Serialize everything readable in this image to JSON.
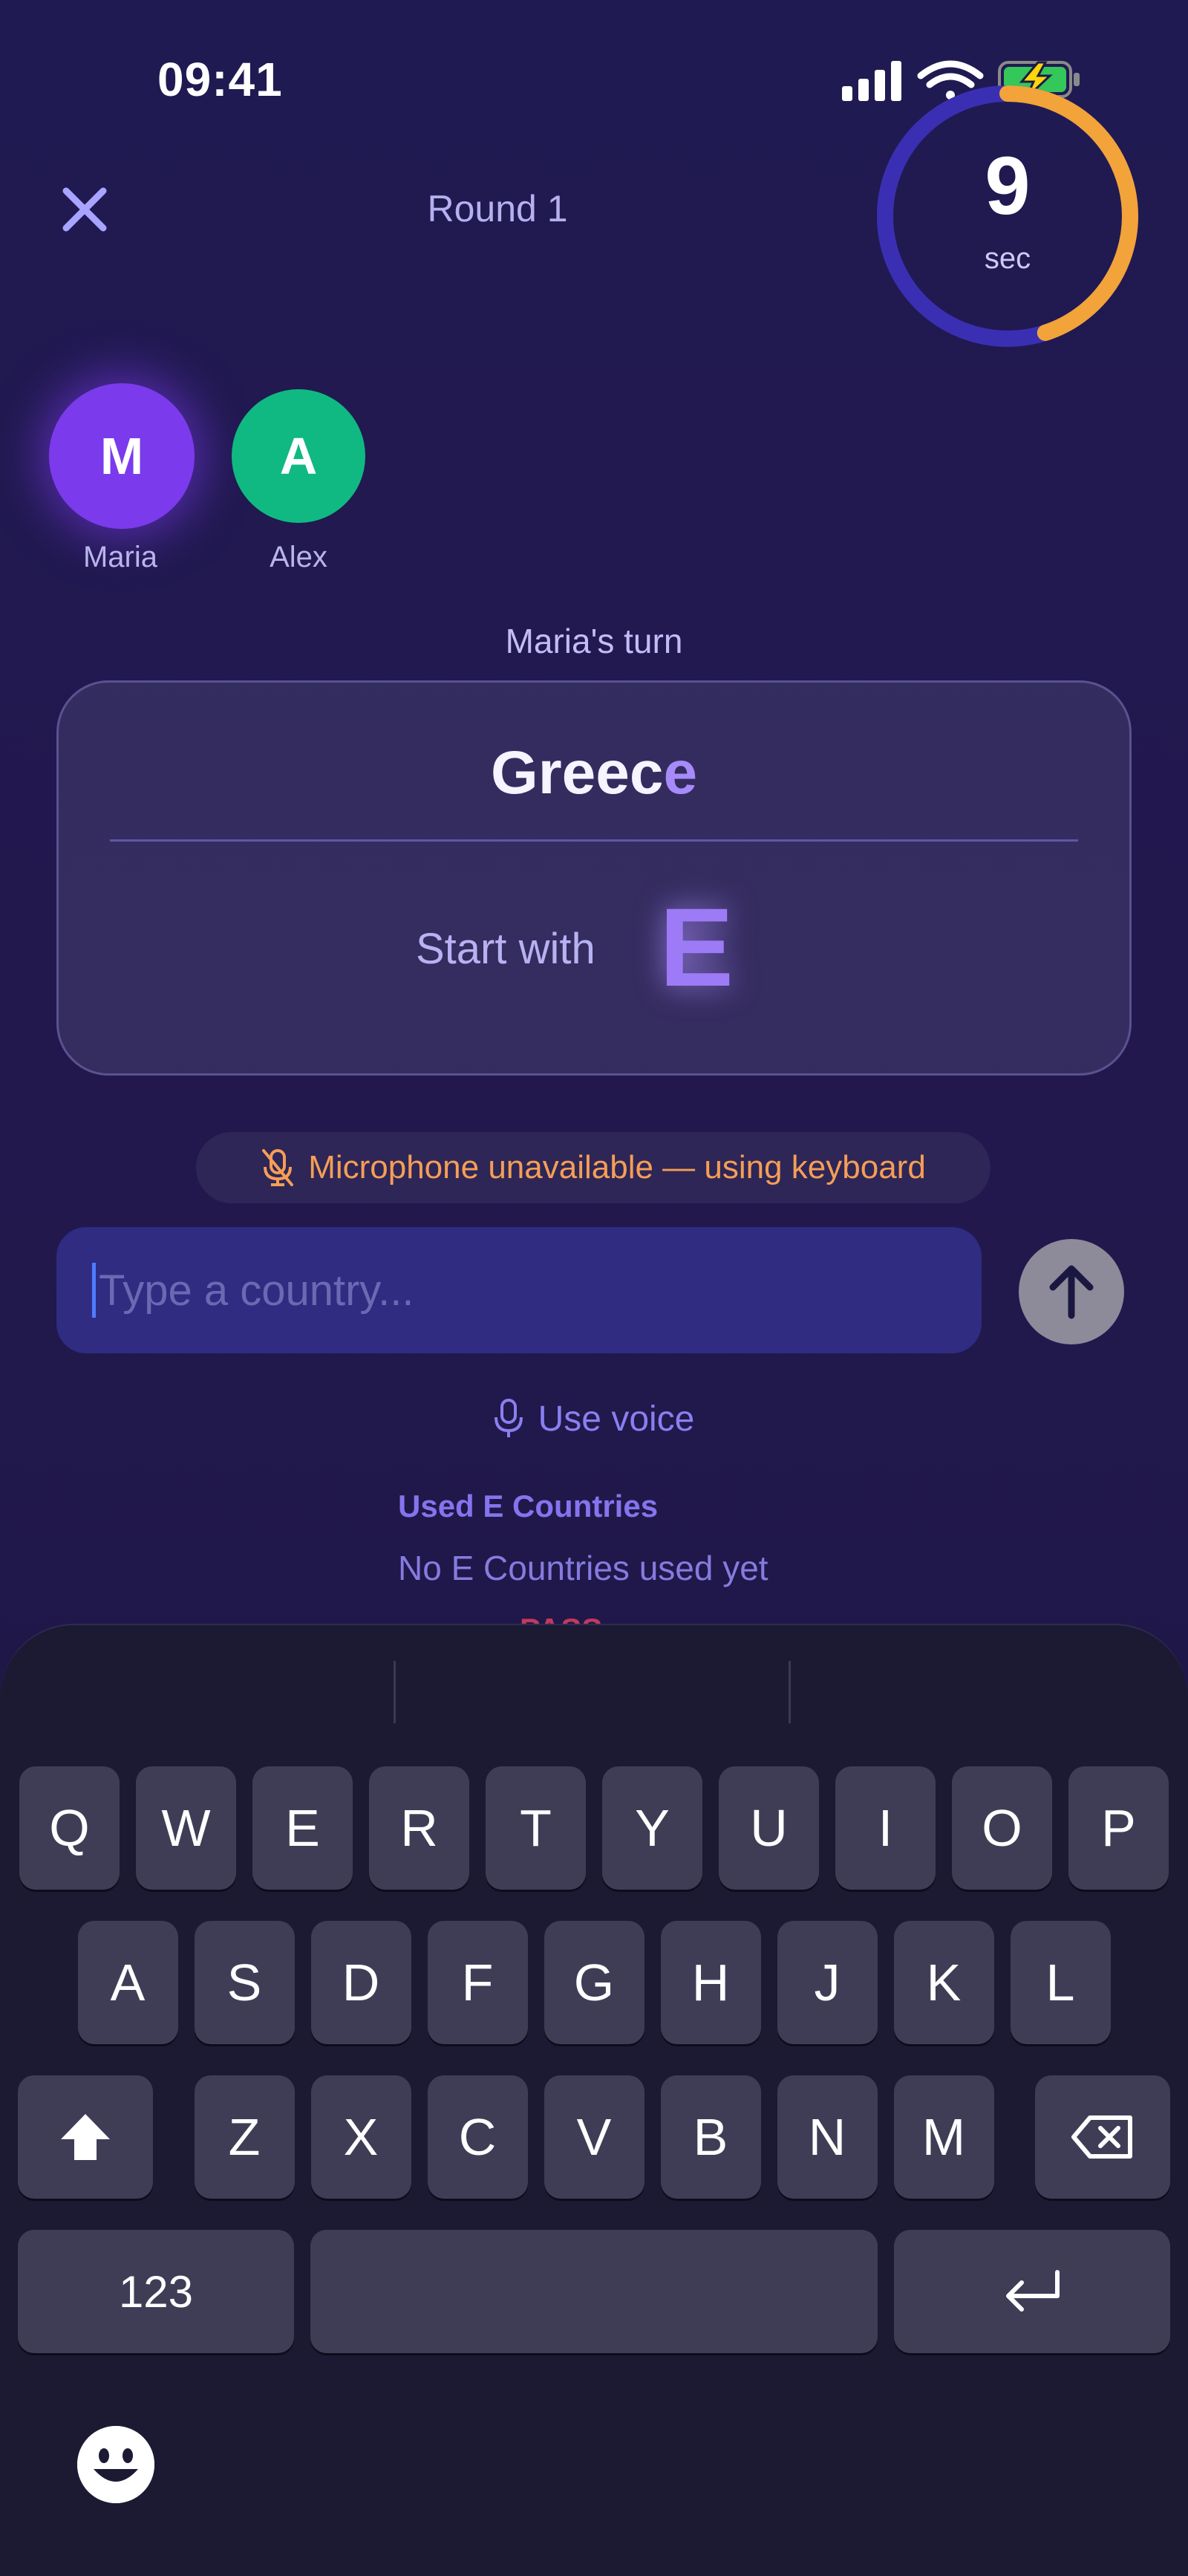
{
  "status_bar": {
    "time": "09:41",
    "icons": [
      "cellular-signal-icon",
      "wifi-icon",
      "battery-charging-icon"
    ]
  },
  "header": {
    "round_title": "Round 1",
    "timer_value": "9",
    "timer_unit": "sec",
    "timer_remaining_fraction": 0.45,
    "timer_colors": {
      "remaining": "#f2a33a",
      "track": "#3a2fb3"
    }
  },
  "players": [
    {
      "initial": "M",
      "name": "Maria",
      "color": "#7c3aed",
      "active": true
    },
    {
      "initial": "A",
      "name": "Alex",
      "color": "#10b981",
      "active": false
    }
  ],
  "turn_text": "Maria's turn",
  "card": {
    "word_start": "Greec",
    "word_last": "e",
    "start_label": "Start with",
    "start_letter": "E"
  },
  "mic_notice": "Microphone unavailable — using keyboard",
  "input": {
    "placeholder": "Type a country..."
  },
  "use_voice": "Use voice",
  "used_section": {
    "title": "Used E Countries",
    "empty_text": "No E Countries used yet",
    "pass_peek": "PASS"
  },
  "keyboard": {
    "row1": [
      "Q",
      "W",
      "E",
      "R",
      "T",
      "Y",
      "U",
      "I",
      "O",
      "P"
    ],
    "row2": [
      "A",
      "S",
      "D",
      "F",
      "G",
      "H",
      "J",
      "K",
      "L"
    ],
    "row3": [
      "Z",
      "X",
      "C",
      "V",
      "B",
      "N",
      "M"
    ],
    "numbers_key": "123",
    "accent": "#a78bfa"
  }
}
